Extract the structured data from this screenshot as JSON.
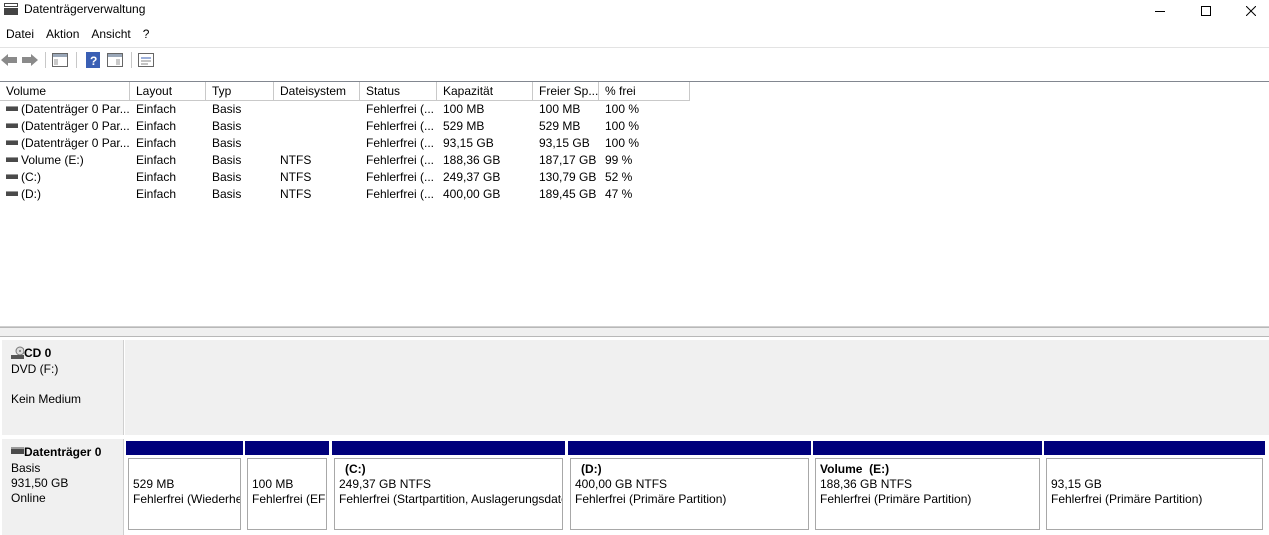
{
  "window": {
    "title": "Datenträgerverwaltung"
  },
  "menu": [
    "Datei",
    "Aktion",
    "Ansicht",
    "?"
  ],
  "volume_list": {
    "columns": [
      "Volume",
      "Layout",
      "Typ",
      "Dateisystem",
      "Status",
      "Kapazität",
      "Freier Sp...",
      "% frei"
    ],
    "rows": [
      [
        "(Datenträger 0 Par...",
        "Einfach",
        "Basis",
        "",
        "Fehlerfrei (...",
        "100 MB",
        "100 MB",
        "100 %"
      ],
      [
        "(Datenträger 0 Par...",
        "Einfach",
        "Basis",
        "",
        "Fehlerfrei (...",
        "529 MB",
        "529 MB",
        "100 %"
      ],
      [
        "(Datenträger 0 Par...",
        "Einfach",
        "Basis",
        "",
        "Fehlerfrei (...",
        "93,15 GB",
        "93,15 GB",
        "100 %"
      ],
      [
        "Volume (E:)",
        "Einfach",
        "Basis",
        "NTFS",
        "Fehlerfrei (...",
        "188,36 GB",
        "187,17 GB",
        "99 %"
      ],
      [
        "(C:)",
        "Einfach",
        "Basis",
        "NTFS",
        "Fehlerfrei (...",
        "249,37 GB",
        "130,79 GB",
        "52 %"
      ],
      [
        "(D:)",
        "Einfach",
        "Basis",
        "NTFS",
        "Fehlerfrei (...",
        "400,00 GB",
        "189,45 GB",
        "47 %"
      ]
    ]
  },
  "disks": {
    "cd": {
      "name": "CD 0",
      "type": "DVD (F:)",
      "status": "Kein Medium"
    },
    "disk0": {
      "name": "Datenträger 0",
      "type": "Basis",
      "size": "931,50 GB",
      "status": "Online",
      "partitions": [
        {
          "name": "",
          "size": "529 MB",
          "status": "Fehlerfrei (Wiederherstellungspartition)"
        },
        {
          "name": "",
          "size": "100 MB",
          "status": "Fehlerfrei (EFI-Systempartition)"
        },
        {
          "name": "(C:)",
          "size": "249,37 GB NTFS",
          "status": "Fehlerfrei (Startpartition, Auslagerungsdatei, Absturzabbild, Primäre Partition)"
        },
        {
          "name": "(D:)",
          "size": "400,00 GB NTFS",
          "status": "Fehlerfrei (Primäre Partition)"
        },
        {
          "name": "Volume  (E:)",
          "size": "188,36 GB NTFS",
          "status": "Fehlerfrei (Primäre Partition)"
        },
        {
          "name": "",
          "size": "93,15 GB",
          "status": "Fehlerfrei (Primäre Partition)"
        }
      ]
    }
  },
  "colors": {
    "partition_bar": "#00007b",
    "label_bg": "#f0f0f0"
  }
}
